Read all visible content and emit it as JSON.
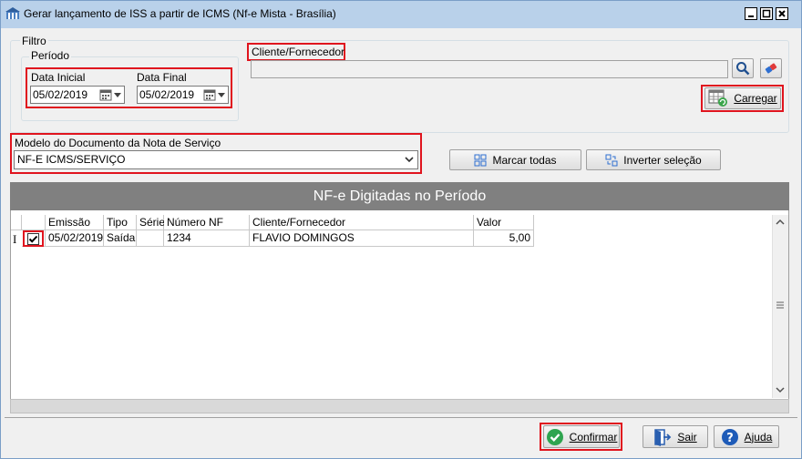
{
  "window": {
    "title": "Gerar lançamento de ISS a partir de ICMS (Nf-e Mista - Brasília)",
    "icon": "app-building-icon"
  },
  "filter": {
    "group_label": "Filtro",
    "period_label": "Período",
    "start_date_label": "Data Inicial",
    "start_date_value": "05/02/2019",
    "end_date_label": "Data Final",
    "end_date_value": "05/02/2019",
    "client_label": "Cliente/Fornecedor",
    "client_value": "",
    "load_button": "Carregar"
  },
  "model": {
    "label": "Modelo do Documento da Nota de Serviço",
    "selected": "NF-E ICMS/SERVIÇO"
  },
  "actions": {
    "mark_all": "Marcar todas",
    "invert_selection": "Inverter seleção"
  },
  "grid": {
    "title": "NF-e Digitadas no Período",
    "columns": [
      "Emissão",
      "Tipo",
      "Série",
      "Número NF",
      "Cliente/Fornecedor",
      "Valor"
    ],
    "rows": [
      {
        "checked": true,
        "emissao": "05/02/2019",
        "tipo": "Saída",
        "serie": "",
        "numero": "1234",
        "cliente": "FLAVIO DOMINGOS",
        "valor": "5,00"
      }
    ],
    "row_marker": "I"
  },
  "footer": {
    "confirm": "Confirmar",
    "exit": "Sair",
    "help": "Ajuda"
  },
  "colors": {
    "highlight": "#e0141e",
    "titlebar": "#b9d1ea",
    "grid_header": "#808080"
  }
}
